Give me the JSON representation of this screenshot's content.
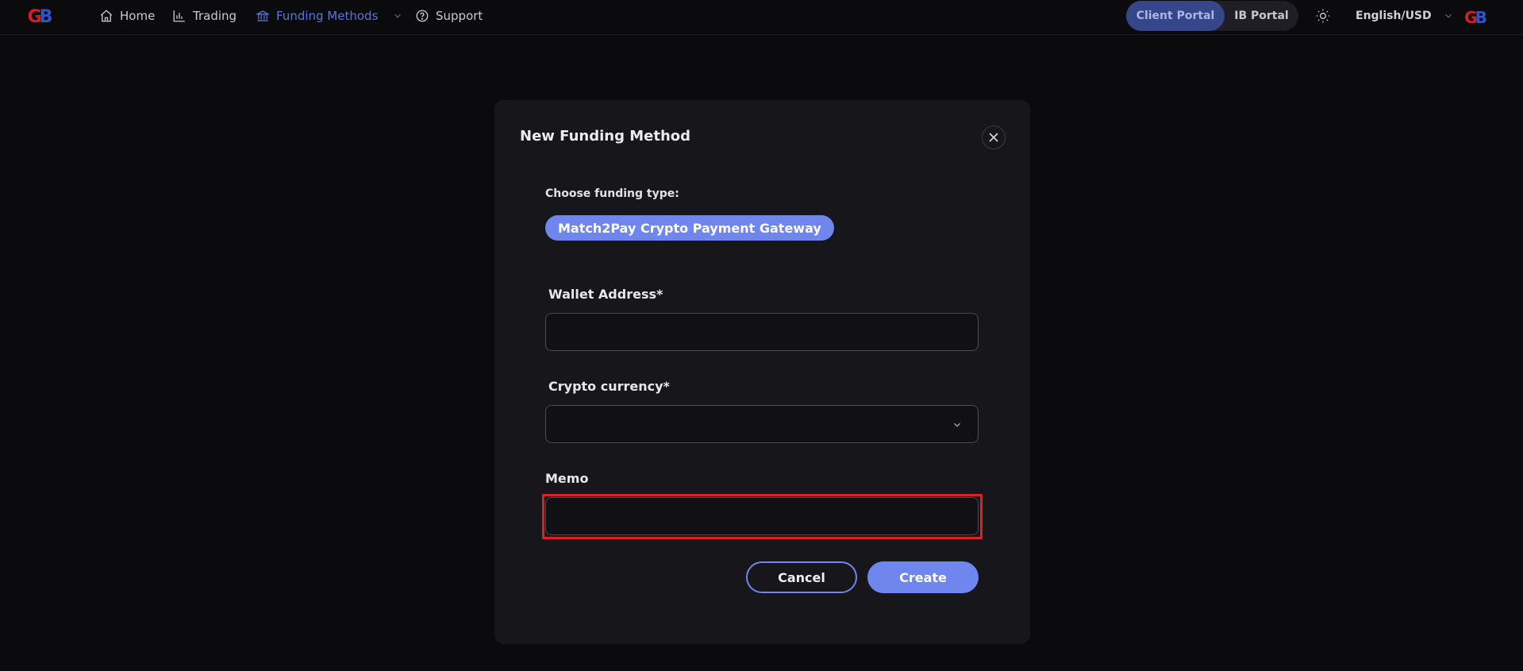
{
  "brand": {
    "logo_text": "GB"
  },
  "nav": {
    "items": [
      {
        "label": "Home",
        "icon": "home-icon"
      },
      {
        "label": "Trading",
        "icon": "bar-chart-icon"
      },
      {
        "label": "Funding Methods",
        "icon": "bank-icon",
        "active": true
      },
      {
        "label": "Support",
        "icon": "help-circle-icon"
      }
    ]
  },
  "portal": {
    "client": "Client Portal",
    "ib": "IB Portal"
  },
  "language": {
    "label": "English/USD"
  },
  "modal": {
    "title": "New Funding Method",
    "choose_label": "Choose funding type:",
    "selected_type": "Match2Pay Crypto Payment Gateway",
    "fields": {
      "wallet": {
        "label": "Wallet Address*",
        "value": "",
        "placeholder": ""
      },
      "crypto": {
        "label": "Crypto currency*",
        "value": ""
      },
      "memo": {
        "label": "Memo",
        "value": "",
        "placeholder": ""
      }
    },
    "buttons": {
      "cancel": "Cancel",
      "create": "Create"
    }
  },
  "colors": {
    "accent": "#6f86ee",
    "nav_active": "#5976d9",
    "highlight": "#e02020",
    "background": "#0b0b0e",
    "modal_bg": "#16161b"
  }
}
